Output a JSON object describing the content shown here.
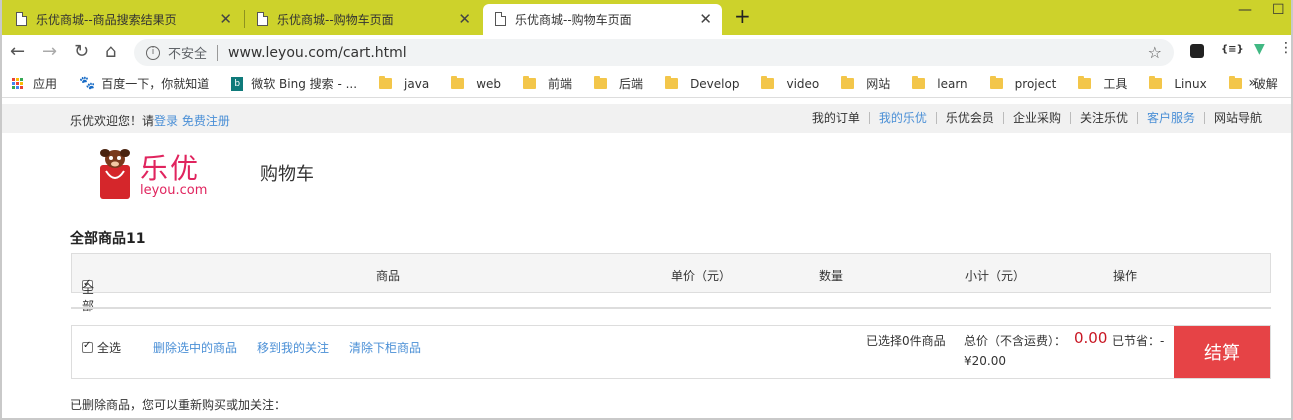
{
  "browser": {
    "tabs": [
      {
        "title": "乐优商城--商品搜索结果页",
        "active": false
      },
      {
        "title": "乐优商城--购物车页面",
        "active": false
      },
      {
        "title": "乐优商城--购物车页面",
        "active": true
      }
    ],
    "new_tab_label": "+",
    "window": {
      "minimize": "—",
      "maximize": "☐"
    },
    "nav": {
      "back": "←",
      "forward": "→",
      "reload": "↻",
      "home": "⌂"
    },
    "address": {
      "security_label": "不安全",
      "url": "www.leyou.com/cart.html"
    },
    "bookmarks": [
      {
        "label": "应用",
        "icon": "apps-icon"
      },
      {
        "label": "百度一下，你就知道",
        "icon": "paw-icon"
      },
      {
        "label": "微软 Bing 搜索 - ...",
        "icon": "bing-icon"
      },
      {
        "label": "java",
        "icon": "folder-icon"
      },
      {
        "label": "web",
        "icon": "folder-icon"
      },
      {
        "label": "前端",
        "icon": "folder-icon"
      },
      {
        "label": "后端",
        "icon": "folder-icon"
      },
      {
        "label": "Develop",
        "icon": "folder-icon"
      },
      {
        "label": "video",
        "icon": "folder-icon"
      },
      {
        "label": "网站",
        "icon": "folder-icon"
      },
      {
        "label": "learn",
        "icon": "folder-icon"
      },
      {
        "label": "project",
        "icon": "folder-icon"
      },
      {
        "label": "工具",
        "icon": "folder-icon"
      },
      {
        "label": "Linux",
        "icon": "folder-icon"
      },
      {
        "label": "破解",
        "icon": "folder-icon"
      }
    ],
    "bookmarks_more": "»"
  },
  "site": {
    "welcome": "乐优欢迎您！请",
    "login": "登录",
    "register": "免费注册",
    "top_nav": [
      "我的订单",
      "我的乐优",
      "乐优会员",
      "企业采购",
      "关注乐优",
      "客户服务",
      "网站导航"
    ],
    "top_nav_highlight": [
      "我的乐优",
      "客户服务"
    ],
    "logo_text": "乐优",
    "logo_domain": "leyou.com",
    "page_title": "购物车"
  },
  "cart": {
    "all_count_label": "全部商品11",
    "header": {
      "select_all": "全部",
      "product": "商品",
      "unit_price": "单价（元）",
      "quantity": "数量",
      "subtotal": "小计（元）",
      "action": "操作"
    },
    "toolbar": {
      "select_all": "全选",
      "delete_selected": "删除选中的商品",
      "move_to_favorites": "移到我的关注",
      "clear_off_shelf": "清除下柜商品",
      "selected_info": "已选择0件商品",
      "sum_label": "总价（不含运费）：",
      "sum_price": "0.00",
      "saved_label": "已节省：-",
      "total_amount": "¥20.00",
      "checkout": "结算"
    },
    "removed_note": "已删除商品，您可以重新购买或加关注："
  },
  "colors": {
    "tab_strip": "#cdd22b",
    "link": "#4a8fd6",
    "price_red": "#c81623",
    "checkout_red": "#e64346"
  }
}
